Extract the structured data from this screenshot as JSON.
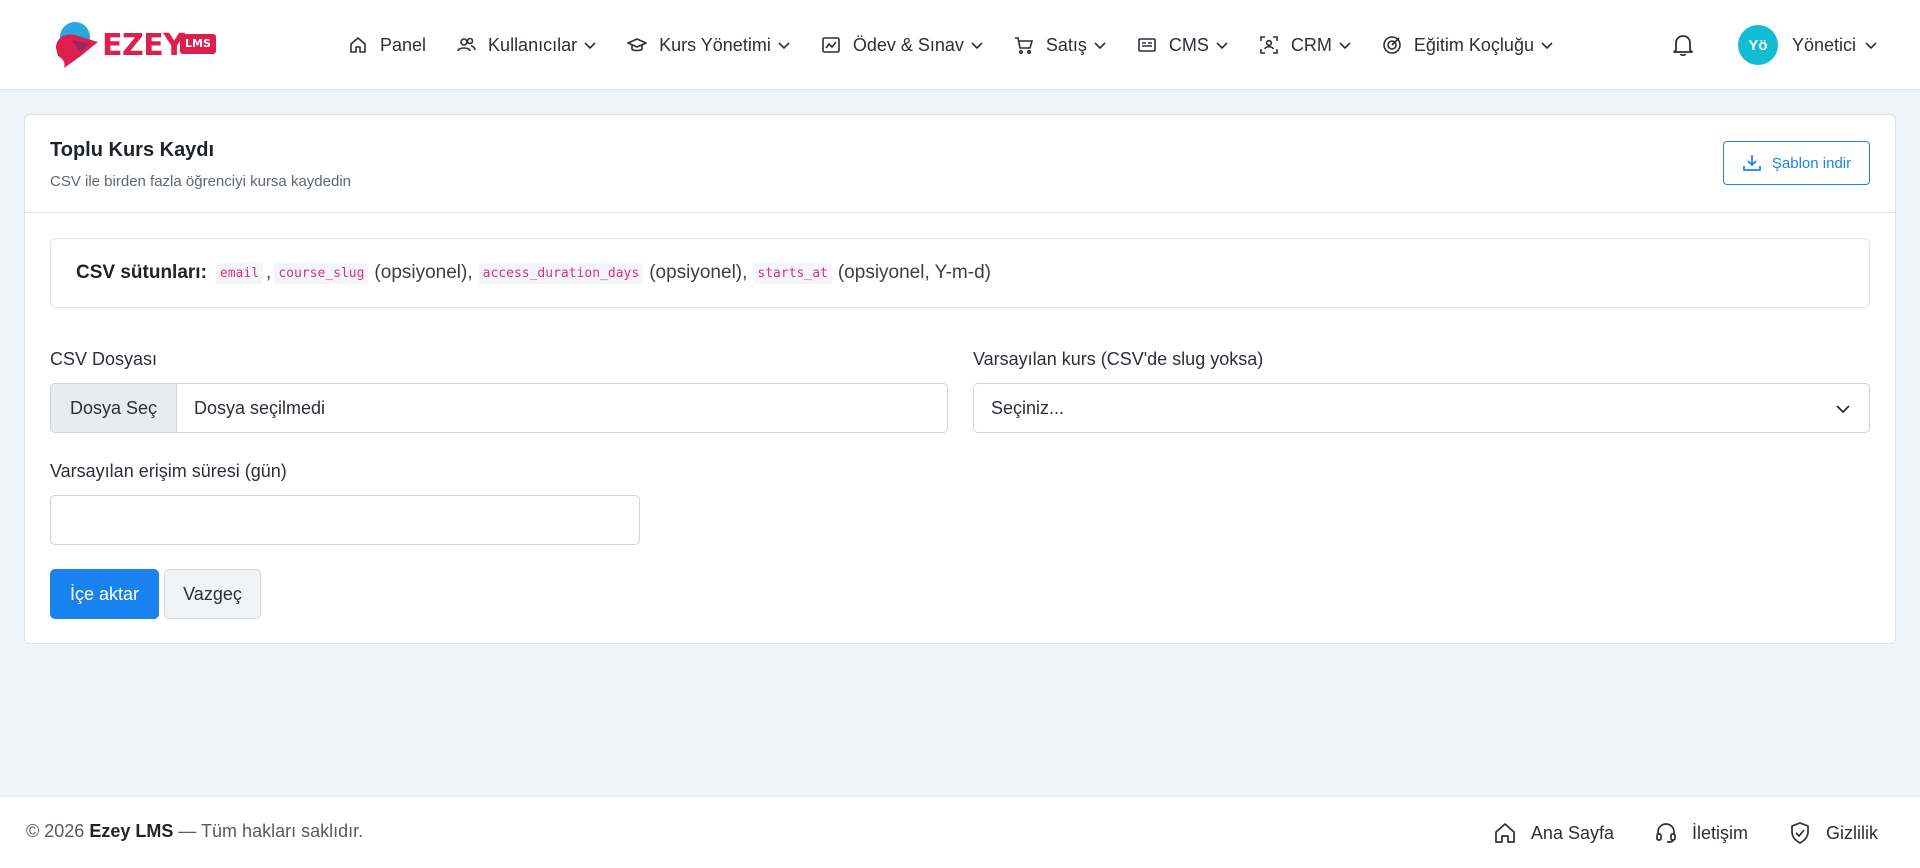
{
  "brand": {
    "name": "EZEY",
    "badge": "LMS"
  },
  "nav": {
    "items": [
      {
        "label": "Panel",
        "icon": "home-icon",
        "dropdown": false
      },
      {
        "label": "Kullanıcılar",
        "icon": "users-icon",
        "dropdown": true
      },
      {
        "label": "Kurs Yönetimi",
        "icon": "graduation-cap-icon",
        "dropdown": true
      },
      {
        "label": "Ödev & Sınav",
        "icon": "chart-board-icon",
        "dropdown": true
      },
      {
        "label": "Satış",
        "icon": "cart-icon",
        "dropdown": true
      },
      {
        "label": "CMS",
        "icon": "newspaper-icon",
        "dropdown": true
      },
      {
        "label": "CRM",
        "icon": "user-focus-icon",
        "dropdown": true
      },
      {
        "label": "Eğitim Koçluğu",
        "icon": "target-icon",
        "dropdown": true
      }
    ],
    "user": {
      "initials": "Yö",
      "name": "Yönetici",
      "avatar_color": "#12bcd2"
    }
  },
  "card": {
    "title": "Toplu Kurs Kaydı",
    "subtitle": "CSV ile birden fazla öğrenciyi kursa kaydedin",
    "template_button": "Şablon indir"
  },
  "csv_info": {
    "label": "CSV sütunları:",
    "col1": "email",
    "sep1": ",",
    "col2": "course_slug",
    "note2": "(opsiyonel),",
    "col3": "access_duration_days",
    "note3": "(opsiyonel),",
    "col4": "starts_at",
    "note4": "(opsiyonel, Y-m-d)"
  },
  "form": {
    "file_label": "CSV Dosyası",
    "file_button": "Dosya Seç",
    "file_status": "Dosya seçilmedi",
    "course_label": "Varsayılan kurs (CSV'de slug yoksa)",
    "course_selected": "Seçiniz...",
    "duration_label": "Varsayılan erişim süresi (gün)",
    "duration_value": "",
    "submit": "İçe aktar",
    "cancel": "Vazgeç"
  },
  "footer": {
    "copyright_prefix": "© 2026",
    "brand": "Ezey LMS",
    "copyright_suffix": "— Tüm hakları saklıdır.",
    "links": [
      "Ana Sayfa",
      "İletişim",
      "Gizlilik"
    ]
  },
  "colors": {
    "primary": "#1a82f0",
    "brand": "#dd1f4e",
    "code": "#d63384",
    "background": "#f0f3f7"
  }
}
